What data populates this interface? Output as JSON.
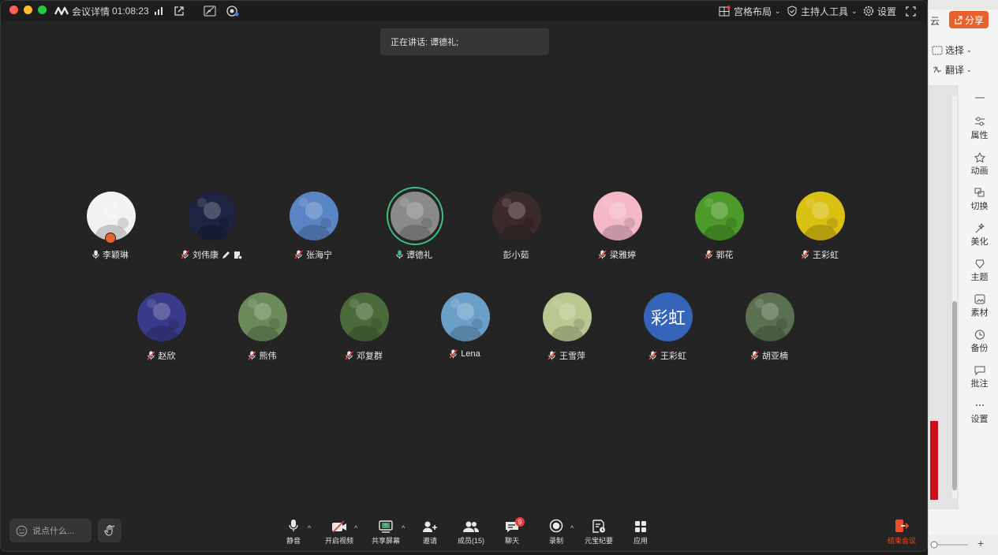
{
  "window": {
    "title": "会议详情",
    "elapsed": "01:08:23",
    "layout_label": "宫格布局",
    "host_tools_label": "主持人工具",
    "settings_label": "设置"
  },
  "speaking": {
    "label": "正在讲话: 谭德礼;"
  },
  "participants": [
    {
      "name": "李颖琳",
      "mic": "on",
      "avatar_color": "#f2f2f2"
    },
    {
      "name": "刘伟康",
      "mic": "muted",
      "avatar_color": "#1d2340"
    },
    {
      "name": "张海宁",
      "mic": "muted",
      "avatar_color": "#5a85c4"
    },
    {
      "name": "谭德礼",
      "mic": "speaking",
      "avatar_color": "#8a8a8a"
    },
    {
      "name": "彭小茹",
      "mic": "none",
      "avatar_color": "#3a2a2a"
    },
    {
      "name": "梁雅婷",
      "mic": "muted",
      "avatar_color": "#f4b8c8"
    },
    {
      "name": "郭花",
      "mic": "muted",
      "avatar_color": "#4c9a2a"
    },
    {
      "name": "王彩虹",
      "mic": "muted",
      "avatar_color": "#d9c012"
    },
    {
      "name": "赵欣",
      "mic": "muted",
      "avatar_color": "#3a3a8a"
    },
    {
      "name": "熊伟",
      "mic": "muted",
      "avatar_color": "#6a8a5a"
    },
    {
      "name": "邓复群",
      "mic": "muted",
      "avatar_color": "#4a6a3a"
    },
    {
      "name": "Lena",
      "mic": "muted",
      "avatar_color": "#6aa0c8"
    },
    {
      "name": "王雪萍",
      "mic": "muted",
      "avatar_color": "#b8c890"
    },
    {
      "name": "王彩虹",
      "mic": "muted",
      "avatar_color": "#3565b8",
      "avatar_text": "彩虹"
    },
    {
      "name": "胡亚楠",
      "mic": "muted",
      "avatar_color": "#5a7050"
    }
  ],
  "chat_input": {
    "placeholder": "说点什么..."
  },
  "toolbar": {
    "mute": "静音",
    "video": "开启视频",
    "share": "共享屏幕",
    "invite": "邀请",
    "members": "成员(15)",
    "chat": "聊天",
    "chat_badge": "9",
    "record": "录制",
    "minutes": "元宝纪要",
    "apps": "应用",
    "end": "结束会议"
  },
  "background_app": {
    "cloud": "云",
    "share": "分享",
    "select": "选择",
    "translate": "翻译",
    "side_items": [
      "属性",
      "动画",
      "切换",
      "美化",
      "主题",
      "素材",
      "备份",
      "批注",
      "设置"
    ]
  },
  "colors": {
    "accent_green": "#3fbf7f",
    "end_red": "#e8502a",
    "badge_red": "#ee3b3b"
  }
}
